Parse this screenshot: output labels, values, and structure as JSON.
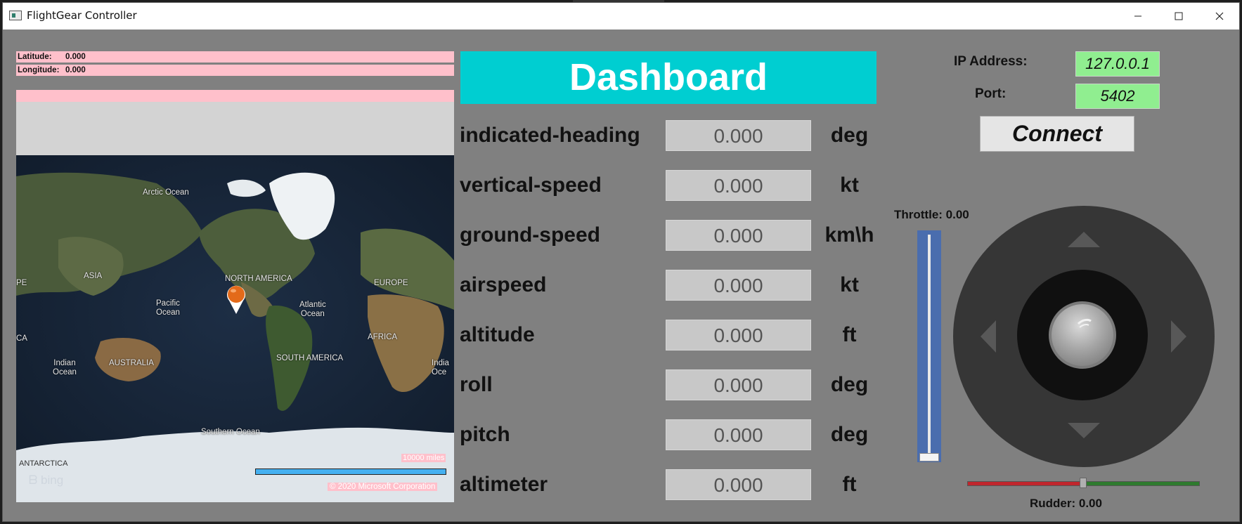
{
  "window": {
    "title": "FlightGear Controller",
    "minimize_icon": "minimize-icon",
    "maximize_icon": "maximize-icon",
    "close_icon": "close-icon"
  },
  "map_panel": {
    "latitude_label": "Latitude:",
    "latitude_value": "0.000",
    "longitude_label": "Longitude:",
    "longitude_value": "0.000",
    "labels": {
      "arctic_ocean": "Arctic Ocean",
      "asia": "ASIA",
      "north_america": "NORTH AMERICA",
      "europe": "EUROPE",
      "pacific_ocean": "Pacific\nOcean",
      "atlantic_ocean": "Atlantic\nOcean",
      "africa": "AFRICA",
      "indian_ocean": "Indian\nOcean",
      "australia": "AUSTRALIA",
      "south_america": "SOUTH AMERICA",
      "southern_ocean": "Southern Ocean",
      "antarctica": "ANTARCTICA",
      "edge_pe": "PE",
      "edge_ca": "CA",
      "edge_india": "India\nOce"
    },
    "scale_label": "10000 miles",
    "copyright": "© 2020 Microsoft Corporation",
    "bing_logo": "bing"
  },
  "dashboard": {
    "title": "Dashboard",
    "rows": [
      {
        "name": "indicated-heading",
        "value": "0.000",
        "unit": "deg"
      },
      {
        "name": "vertical-speed",
        "value": "0.000",
        "unit": "kt"
      },
      {
        "name": "ground-speed",
        "value": "0.000",
        "unit": "km\\h"
      },
      {
        "name": "airspeed",
        "value": "0.000",
        "unit": "kt"
      },
      {
        "name": "altitude",
        "value": "0.000",
        "unit": "ft"
      },
      {
        "name": "roll",
        "value": "0.000",
        "unit": "deg"
      },
      {
        "name": "pitch",
        "value": "0.000",
        "unit": "deg"
      },
      {
        "name": "altimeter",
        "value": "0.000",
        "unit": "ft"
      }
    ]
  },
  "connection": {
    "ip_label": "IP Address:",
    "ip_value": "127.0.0.1",
    "port_label": "Port:",
    "port_value": "5402",
    "connect_label": "Connect"
  },
  "controls": {
    "throttle_label": "Throttle: 0.00",
    "throttle_level": 0.0,
    "rudder_label": "Rudder: 0.00",
    "rudder_level": 0.0
  },
  "colors": {
    "background": "#808080",
    "dashboard_header": "#00ced1",
    "coord_pink": "#ffc0cb",
    "field_green": "#90ee90",
    "throttle_blue": "#4a6dae",
    "rudder_red": "#c0262d",
    "rudder_green": "#2e7a2e"
  }
}
